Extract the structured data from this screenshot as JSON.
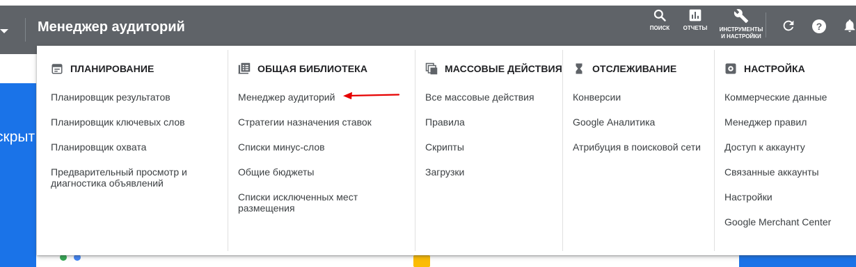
{
  "header": {
    "title": "Менеджер аудиторий",
    "tools": [
      {
        "label": "ПОИСК",
        "icon": "search-icon"
      },
      {
        "label": "ОТЧЕТЫ",
        "icon": "reports-icon"
      },
      {
        "label": "ИНСТРУМЕНТЫ И НАСТРОЙКИ",
        "icon": "wrench-icon"
      }
    ],
    "icons": [
      "refresh-icon",
      "help-icon",
      "bell-icon"
    ]
  },
  "background": {
    "partial_text": "скрыт"
  },
  "menu": {
    "columns": [
      {
        "title": "ПЛАНИРОВАНИЕ",
        "icon": "calendar-icon",
        "items": [
          "Планировщик результатов",
          "Планировщик ключевых слов",
          "Планировщик охвата",
          "Предварительный просмотр и диагностика объявлений"
        ]
      },
      {
        "title": "ОБЩАЯ БИБЛИОТЕКА",
        "icon": "library-icon",
        "items": [
          "Менеджер аудиторий",
          "Стратегии назначения ставок",
          "Списки минус-слов",
          "Общие бюджеты",
          "Списки исключенных мест размещения"
        ]
      },
      {
        "title": "МАССОВЫЕ ДЕЙСТВИЯ",
        "icon": "bulk-actions-icon",
        "items": [
          "Все массовые действия",
          "Правила",
          "Скрипты",
          "Загрузки"
        ]
      },
      {
        "title": "ОТСЛЕЖИВАНИЕ",
        "icon": "hourglass-icon",
        "items": [
          "Конверсии",
          "Google Аналитика",
          "Атрибуция в поисковой сети"
        ]
      },
      {
        "title": "НАСТРОЙКА",
        "icon": "settings-icon",
        "items": [
          "Коммерческие данные",
          "Менеджер правил",
          "Доступ к аккаунту",
          "Связанные аккаунты",
          "Настройки",
          "Google Merchant Center"
        ]
      }
    ]
  },
  "colors": {
    "topbar": "#5f6368",
    "accent_blue": "#1a73e8",
    "annotation_arrow": "#e60000"
  }
}
